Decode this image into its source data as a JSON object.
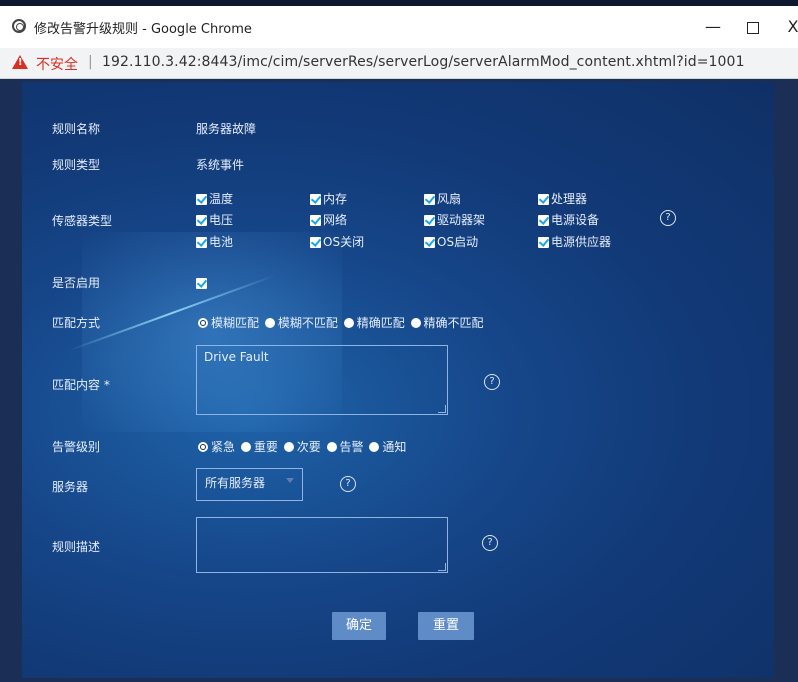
{
  "window": {
    "title": "修改告警升级规则 - Google Chrome",
    "minimize_glyph": "—",
    "close_glyph": "X"
  },
  "address": {
    "security_label": "不安全",
    "separator": "|",
    "url": "192.110.3.42:8443/imc/cim/serverRes/serverLog/serverAlarmMod_content.xhtml?id=1001"
  },
  "form": {
    "rule_name": {
      "label": "规则名称",
      "value": "服务器故障"
    },
    "rule_type": {
      "label": "规则类型",
      "value": "系统事件"
    },
    "sensor_type": {
      "label": "传感器类型",
      "options": [
        {
          "label": "温度",
          "checked": true
        },
        {
          "label": "内存",
          "checked": true
        },
        {
          "label": "风扇",
          "checked": true
        },
        {
          "label": "处理器",
          "checked": true
        },
        {
          "label": "电压",
          "checked": true
        },
        {
          "label": "网络",
          "checked": true
        },
        {
          "label": "驱动器架",
          "checked": true
        },
        {
          "label": "电源设备",
          "checked": true
        },
        {
          "label": "电池",
          "checked": true
        },
        {
          "label": "OS关闭",
          "checked": true
        },
        {
          "label": "OS启动",
          "checked": true
        },
        {
          "label": "电源供应器",
          "checked": true
        }
      ]
    },
    "enabled": {
      "label": "是否启用",
      "checked": true
    },
    "match_mode": {
      "label": "匹配方式",
      "options": [
        "模糊匹配",
        "模糊不匹配",
        "精确匹配",
        "精确不匹配"
      ],
      "selected": "模糊匹配"
    },
    "match_content": {
      "label": "匹配内容 *",
      "value": "Drive Fault"
    },
    "alarm_level": {
      "label": "告警级别",
      "options": [
        "紧急",
        "重要",
        "次要",
        "告警",
        "通知"
      ],
      "selected": "紧急"
    },
    "server": {
      "label": "服务器",
      "selected": "所有服务器"
    },
    "description": {
      "label": "规则描述",
      "value": ""
    },
    "help_glyph": "?"
  },
  "buttons": {
    "ok": "确定",
    "reset": "重置"
  },
  "colors": {
    "panel": "#16478a",
    "button": "#5f8cc6",
    "checkbox_tick": "#1aa6e8",
    "insecure": "#d93025"
  }
}
